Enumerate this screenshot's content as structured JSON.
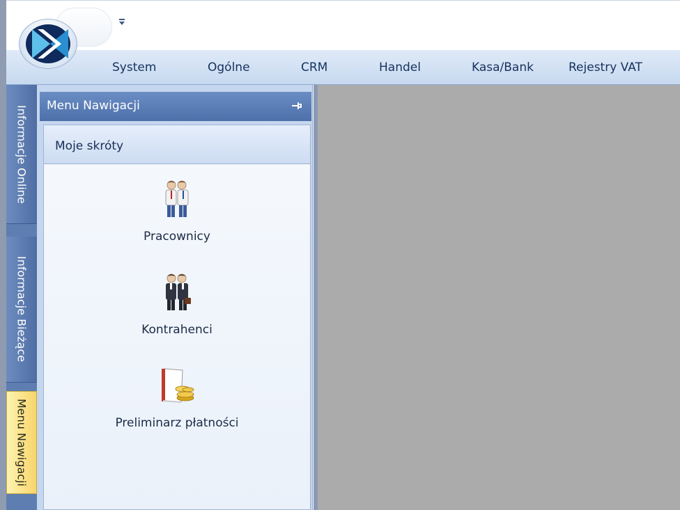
{
  "ribbon": {
    "tabs": [
      {
        "label": "System"
      },
      {
        "label": "Ogólne"
      },
      {
        "label": "CRM"
      },
      {
        "label": "Handel"
      },
      {
        "label": "Kasa/Bank"
      },
      {
        "label": "Rejestry VAT"
      }
    ]
  },
  "side_tabs": {
    "online": "Informacje Online",
    "biezace": "Informacje Bieżące",
    "menu": "Menu Nawigacji"
  },
  "nav_panel": {
    "title": "Menu Nawigacji",
    "group_title": "Moje skróty",
    "shortcuts": [
      {
        "label": "Pracownicy",
        "icon": "employees-icon"
      },
      {
        "label": "Kontrahenci",
        "icon": "contractors-icon"
      },
      {
        "label": "Preliminarz płatności",
        "icon": "payment-schedule-icon"
      }
    ]
  },
  "colors": {
    "ribbon": "#c7d9f0",
    "nav_header": "#5a7db6",
    "active_side_tab": "#f7d56b",
    "workspace": "#ababab"
  }
}
